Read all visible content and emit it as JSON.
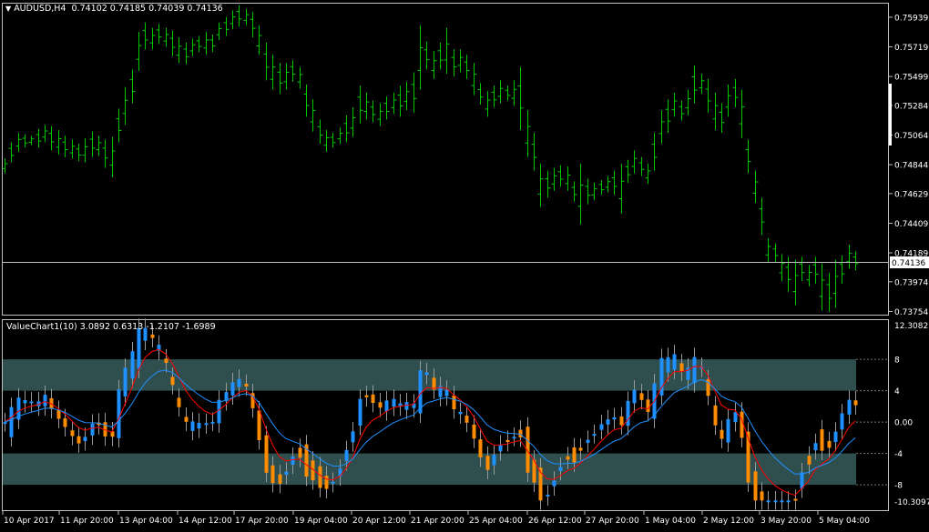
{
  "main_chart": {
    "symbol_label": "AUDUSD,H4",
    "ohlc": "0.74102 0.74185 0.74039 0.74136",
    "current_price": "0.74136",
    "price_levels": [
      "0.75939",
      "0.75719",
      "0.75499",
      "0.75284",
      "0.75064",
      "0.74844",
      "0.74629",
      "0.74409",
      "0.74189",
      "0.73974",
      "0.73754"
    ],
    "bar_color": "#00c800",
    "ylim": [
      0.7373,
      0.7604
    ],
    "series_high_low": [
      [
        0.7489,
        0.7478
      ],
      [
        0.7501,
        0.7486
      ],
      [
        0.7508,
        0.7494
      ],
      [
        0.7507,
        0.7497
      ],
      [
        0.7506,
        0.7499
      ],
      [
        0.7511,
        0.7497
      ],
      [
        0.7514,
        0.7501
      ],
      [
        0.7513,
        0.7495
      ],
      [
        0.751,
        0.7492
      ],
      [
        0.7506,
        0.749
      ],
      [
        0.7503,
        0.7489
      ],
      [
        0.75,
        0.7487
      ],
      [
        0.7504,
        0.7486
      ],
      [
        0.7509,
        0.749
      ],
      [
        0.7506,
        0.7491
      ],
      [
        0.7503,
        0.7482
      ],
      [
        0.7505,
        0.7475
      ],
      [
        0.7526,
        0.7501
      ],
      [
        0.7542,
        0.7514
      ],
      [
        0.7555,
        0.753
      ],
      [
        0.7583,
        0.7554
      ],
      [
        0.759,
        0.757
      ],
      [
        0.7586,
        0.757
      ],
      [
        0.7589,
        0.7574
      ],
      [
        0.7586,
        0.7572
      ],
      [
        0.7584,
        0.7565
      ],
      [
        0.7579,
        0.756
      ],
      [
        0.7575,
        0.7559
      ],
      [
        0.7578,
        0.7565
      ],
      [
        0.758,
        0.7568
      ],
      [
        0.7583,
        0.7566
      ],
      [
        0.7581,
        0.7568
      ],
      [
        0.759,
        0.7577
      ],
      [
        0.7594,
        0.758
      ],
      [
        0.7599,
        0.7585
      ],
      [
        0.7603,
        0.7587
      ],
      [
        0.76,
        0.7588
      ],
      [
        0.7598,
        0.7579
      ],
      [
        0.7588,
        0.7566
      ],
      [
        0.7575,
        0.7547
      ],
      [
        0.7566,
        0.754
      ],
      [
        0.756,
        0.7537
      ],
      [
        0.756,
        0.754
      ],
      [
        0.7562,
        0.7546
      ],
      [
        0.7557,
        0.7541
      ],
      [
        0.7544,
        0.752
      ],
      [
        0.7533,
        0.7509
      ],
      [
        0.7518,
        0.75
      ],
      [
        0.751,
        0.7494
      ],
      [
        0.7508,
        0.7497
      ],
      [
        0.7512,
        0.75
      ],
      [
        0.7521,
        0.7501
      ],
      [
        0.7527,
        0.7505
      ],
      [
        0.7543,
        0.7515
      ],
      [
        0.7538,
        0.7518
      ],
      [
        0.7532,
        0.7516
      ],
      [
        0.753,
        0.7513
      ],
      [
        0.7535,
        0.7518
      ],
      [
        0.7538,
        0.7522
      ],
      [
        0.7543,
        0.752
      ],
      [
        0.7546,
        0.7525
      ],
      [
        0.7553,
        0.7523
      ],
      [
        0.7588,
        0.754
      ],
      [
        0.7576,
        0.7555
      ],
      [
        0.7569,
        0.7548
      ],
      [
        0.7575,
        0.7555
      ],
      [
        0.7586,
        0.7552
      ],
      [
        0.757,
        0.755
      ],
      [
        0.757,
        0.7553
      ],
      [
        0.7566,
        0.7548
      ],
      [
        0.756,
        0.7536
      ],
      [
        0.7545,
        0.7529
      ],
      [
        0.7539,
        0.752
      ],
      [
        0.7543,
        0.7527
      ],
      [
        0.7547,
        0.753
      ],
      [
        0.7543,
        0.7532
      ],
      [
        0.7547,
        0.7528
      ],
      [
        0.7557,
        0.751
      ],
      [
        0.7525,
        0.749
      ],
      [
        0.7508,
        0.748
      ],
      [
        0.7485,
        0.7453
      ],
      [
        0.748,
        0.746
      ],
      [
        0.7482,
        0.7465
      ],
      [
        0.7484,
        0.7468
      ],
      [
        0.7483,
        0.7465
      ],
      [
        0.7472,
        0.7457
      ],
      [
        0.7485,
        0.744
      ],
      [
        0.7474,
        0.7455
      ],
      [
        0.7471,
        0.7458
      ],
      [
        0.7473,
        0.7462
      ],
      [
        0.7476,
        0.7464
      ],
      [
        0.748,
        0.7462
      ],
      [
        0.7485,
        0.7448
      ],
      [
        0.7488,
        0.7471
      ],
      [
        0.7495,
        0.7478
      ],
      [
        0.749,
        0.7476
      ],
      [
        0.7485,
        0.747
      ],
      [
        0.7508,
        0.748
      ],
      [
        0.7525,
        0.75
      ],
      [
        0.7533,
        0.7508
      ],
      [
        0.7538,
        0.752
      ],
      [
        0.7532,
        0.7517
      ],
      [
        0.754,
        0.7521
      ],
      [
        0.7558,
        0.753
      ],
      [
        0.7552,
        0.7537
      ],
      [
        0.7548,
        0.7523
      ],
      [
        0.7538,
        0.751
      ],
      [
        0.753,
        0.7508
      ],
      [
        0.7544,
        0.752
      ],
      [
        0.7548,
        0.7527
      ],
      [
        0.754,
        0.7504
      ],
      [
        0.7503,
        0.7478
      ],
      [
        0.748,
        0.7456
      ],
      [
        0.746,
        0.7432
      ],
      [
        0.743,
        0.7412
      ],
      [
        0.7426,
        0.7412
      ],
      [
        0.7418,
        0.7398
      ],
      [
        0.7416,
        0.739
      ],
      [
        0.7414,
        0.738
      ],
      [
        0.7416,
        0.7398
      ],
      [
        0.741,
        0.7394
      ],
      [
        0.7416,
        0.7396
      ],
      [
        0.7411,
        0.7376
      ],
      [
        0.7404,
        0.7375
      ],
      [
        0.7414,
        0.7378
      ],
      [
        0.7417,
        0.7396
      ],
      [
        0.7425,
        0.7407
      ],
      [
        0.742,
        0.7406
      ]
    ]
  },
  "indicator": {
    "label": "ValueChart1(10) 3.0892 0.6313 -1.2107 -1.6989",
    "top_value": "12.3082",
    "bottom_value": "-10.3097",
    "levels": [
      "8",
      "4",
      "0.00",
      "-4",
      "-8"
    ],
    "ylim": [
      -10.3097,
      12.3082
    ],
    "band_color": "#2f4f4f",
    "up_color": "#1e90ff",
    "down_color": "#ff8c00"
  },
  "time_axis": [
    "10 Apr 2017",
    "11 Apr 20:00",
    "13 Apr 04:00",
    "14 Apr 12:00",
    "17 Apr 20:00",
    "19 Apr 04:00",
    "20 Apr 12:00",
    "21 Apr 20:00",
    "25 Apr 04:00",
    "26 Apr 12:00",
    "27 Apr 20:00",
    "1 May 04:00",
    "2 May 12:00",
    "3 May 20:00",
    "5 May 04:00"
  ]
}
